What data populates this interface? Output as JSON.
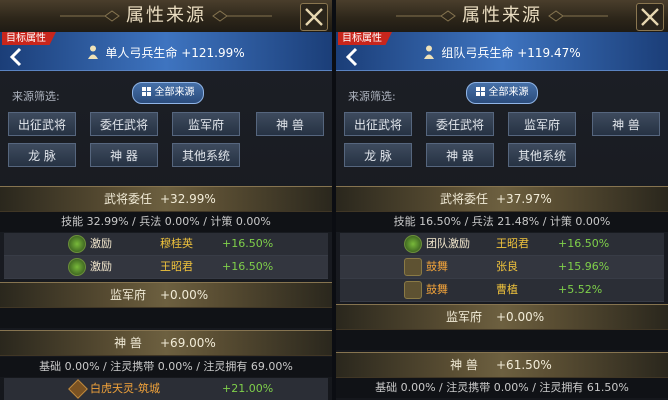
{
  "window_title": "属性来源",
  "target_tag": "目标属性",
  "filter_label": "来源筛选:",
  "all_sources_label": "全部来源",
  "filters_row1": [
    "出征武将",
    "委任武将",
    "监军府",
    "神 兽"
  ],
  "filters_row2": [
    "龙 脉",
    "神 器",
    "其他系统"
  ],
  "left": {
    "attribute": "单人弓兵生命",
    "attribute_value": "+121.99%",
    "s1": {
      "name": "武将委任",
      "value": "+32.99%"
    },
    "s1_stats": "技能  32.99%  /  兵法  0.00%  /  计策  0.00%",
    "s1_rows": [
      {
        "type": "激励",
        "name": "穆桂英",
        "value": "+16.50%"
      },
      {
        "type": "激励",
        "name": "王昭君",
        "value": "+16.50%"
      }
    ],
    "s2": {
      "name": "监军府",
      "value": "+0.00%"
    },
    "s3": {
      "name": "神 兽",
      "value": "+69.00%"
    },
    "s3_stats": "基础  0.00%  /  注灵携带  0.00%  /  注灵拥有  69.00%",
    "s3_row": {
      "type": "白虎天灵-筑城",
      "value": "+21.00%"
    }
  },
  "right": {
    "attribute": "组队弓兵生命",
    "attribute_value": "+119.47%",
    "s1": {
      "name": "武将委任",
      "value": "+37.97%"
    },
    "s1_stats": "技能  16.50%  /  兵法  21.48%  /  计策  0.00%",
    "s1_rows": [
      {
        "type": "团队激励",
        "name": "王昭君",
        "value": "+16.50%"
      },
      {
        "type": "鼓舞",
        "name": "张良",
        "value": "+15.96%"
      },
      {
        "type": "鼓舞",
        "name": "曹植",
        "value": "+5.52%"
      }
    ],
    "s2": {
      "name": "监军府",
      "value": "+0.00%"
    },
    "s3": {
      "name": "神 兽",
      "value": "+61.50%"
    },
    "s3_stats": "基础  0.00%  /  注灵携带  0.00%  /  注灵拥有  61.50%"
  },
  "colors": {
    "accent_gold": "#f0c33c",
    "value_green": "#7fd04a",
    "tag_red": "#c8261c",
    "header_blue": "#3e74c0"
  }
}
